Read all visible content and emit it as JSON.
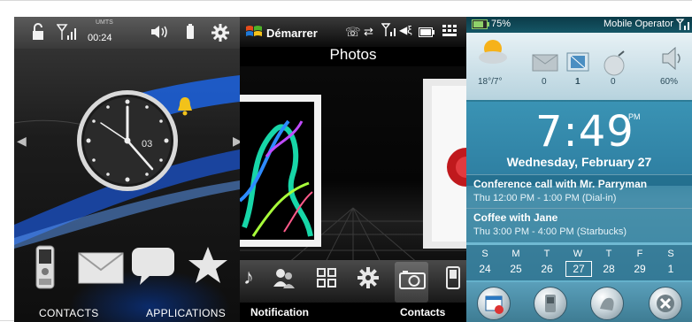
{
  "panel1": {
    "status": {
      "time": "00:24",
      "network": "UMTS"
    },
    "clock": {
      "date_number": "03"
    },
    "dock": {
      "contacts_label": "CONTACTS",
      "applications_label": "APPLICATIONS"
    }
  },
  "panel2": {
    "status": {
      "start_label": "Démarrer"
    },
    "title": "Photos",
    "softkeys": {
      "left": "Notification",
      "right": "Contacts"
    }
  },
  "panel3": {
    "status": {
      "battery": "75%",
      "operator": "Mobile Operator"
    },
    "weather": {
      "temp": "18°/7°",
      "messages": "0",
      "email": "1",
      "missed": "0",
      "volume": "60%"
    },
    "time": "7:49",
    "ampm": "PM",
    "date": "Wednesday, February 27",
    "appointments": [
      {
        "title": "Conference call with Mr. Parryman",
        "detail": "Thu 12:00 PM - 1:00 PM (Dial-in)"
      },
      {
        "title": "Coffee with Jane",
        "detail": "Thu 3:00 PM - 4:00 PM (Starbucks)"
      }
    ],
    "week": {
      "days": [
        "S",
        "M",
        "T",
        "W",
        "T",
        "F",
        "S"
      ],
      "dates": [
        "24",
        "25",
        "26",
        "27",
        "28",
        "29",
        "1"
      ]
    }
  }
}
